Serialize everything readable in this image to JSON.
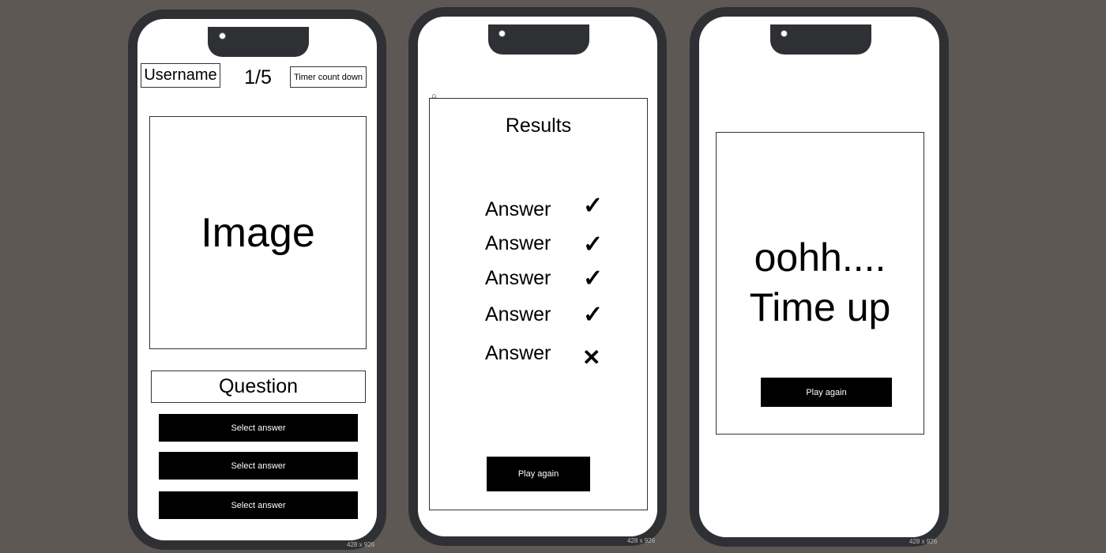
{
  "quiz_screen": {
    "username": "Username",
    "progress": "1/5",
    "timer": "Timer count down",
    "image_placeholder": "Image",
    "question": "Question",
    "answers": [
      "Select answer",
      "Select answer",
      "Select answer"
    ],
    "size_tag": "428 x 926"
  },
  "results_screen": {
    "title": "Results",
    "results": [
      {
        "label": "Answer",
        "mark": "✓",
        "correct": true
      },
      {
        "label": "Answer",
        "mark": "✓",
        "correct": true
      },
      {
        "label": "Answer",
        "mark": "✓",
        "correct": true
      },
      {
        "label": "Answer",
        "mark": "✓",
        "correct": true
      },
      {
        "label": "Answer",
        "mark": "✕",
        "correct": false
      }
    ],
    "play_again": "Play again",
    "size_tag": "428 x 926"
  },
  "timeout_screen": {
    "line1": "oohh....",
    "line2": "Time up",
    "play_again": "Play again",
    "size_tag": "428 x 926"
  }
}
